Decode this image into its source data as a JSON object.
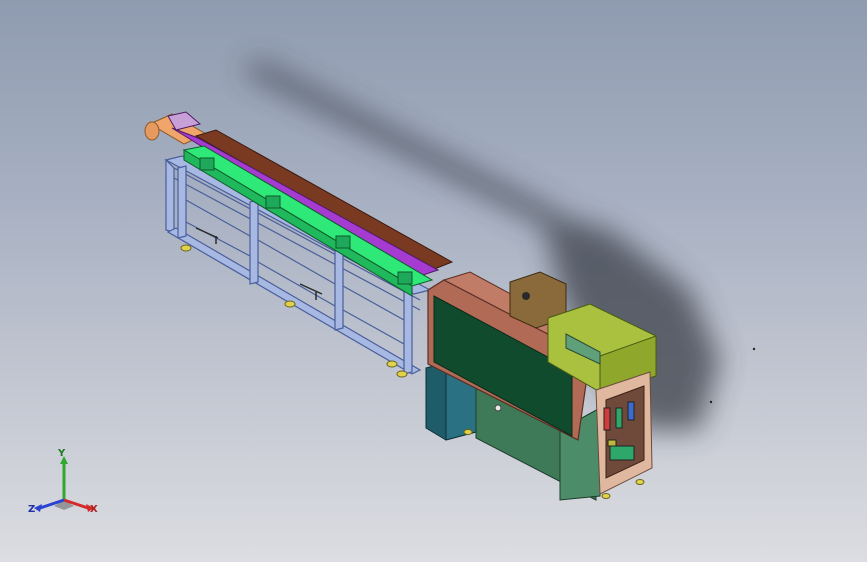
{
  "triad": {
    "x_label": "X",
    "y_label": "Y",
    "z_label": "Z"
  },
  "colors": {
    "frame": "#a7b8e3",
    "conveyor_green": "#2ee878",
    "rail_purple": "#a53bd0",
    "rail_brown": "#7a3a22",
    "housing_brown": "#b06a55",
    "panel_green": "#114b2e",
    "electrical_teal": "#1f5c6a",
    "cabinet_green": "#3e7a58",
    "olive_unit": "#a9c13f",
    "motor_box": "#8a6a3a",
    "shadow": "#3b3f48"
  },
  "icons": [
    "coordinate-triad-icon"
  ]
}
